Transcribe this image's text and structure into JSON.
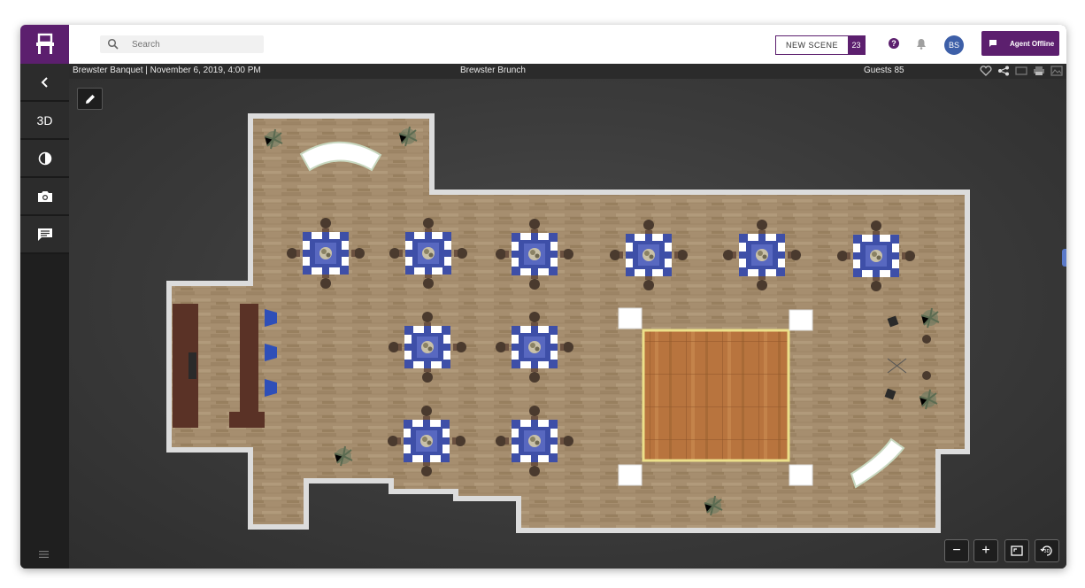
{
  "search": {
    "placeholder": "Search",
    "icon": "search-icon"
  },
  "header": {
    "new_scene_label": "NEW SCENE",
    "new_scene_count": "23",
    "help_label": "?",
    "avatar_initials": "BS",
    "agent_label": "Agent Offline",
    "brand_color": "#5c1f6e"
  },
  "event": {
    "title": "Brewster Banquet | November 6, 2019, 4:00 PM",
    "scene_name": "Brewster Brunch",
    "guests": "Guests 85"
  },
  "sidebar": {
    "items": [
      {
        "name": "back",
        "icon": "chevron-left-icon"
      },
      {
        "name": "3d",
        "label": "3D"
      },
      {
        "name": "contrast",
        "icon": "contrast-icon"
      },
      {
        "name": "camera",
        "icon": "camera-icon"
      },
      {
        "name": "chat",
        "icon": "chat-icon"
      }
    ]
  },
  "zoom_controls": {
    "out": "−",
    "in": "+"
  }
}
